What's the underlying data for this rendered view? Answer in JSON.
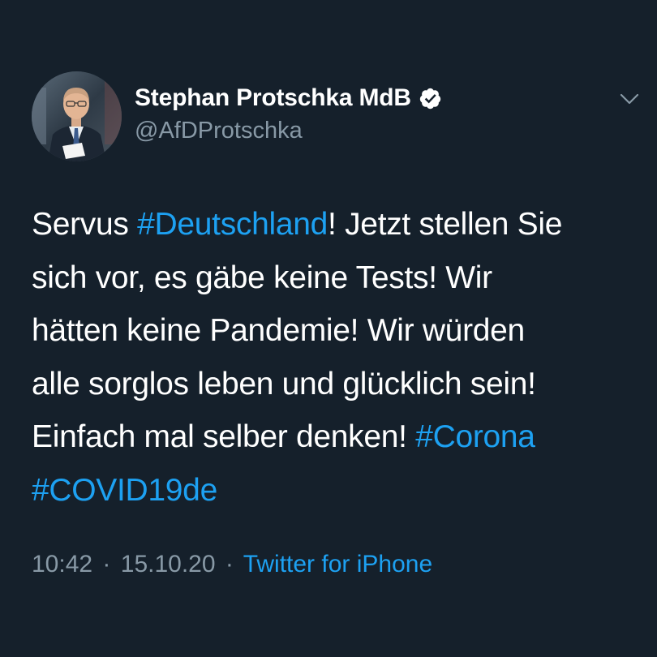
{
  "author": {
    "display_name": "Stephan Protschka MdB",
    "handle": "@AfDProtschka",
    "verified": true,
    "verified_icon": "verified-badge-icon"
  },
  "tweet": {
    "line1": {
      "t1": "Servus ",
      "tag": "#Deutschland",
      "t2": "! Jetzt stellen Sie"
    },
    "line2": "sich vor, es gäbe keine Tests! Wir",
    "line3": "hätten keine Pandemie! Wir würden",
    "line4": "alle sorglos leben und glücklich sein!",
    "line5": {
      "t1": "Einfach mal selber denken! ",
      "tag": "#Corona"
    },
    "line6": {
      "tag": "#COVID19de"
    }
  },
  "meta": {
    "time": "10:42",
    "separator": "·",
    "date": "15.10.20",
    "source": "Twitter for iPhone"
  },
  "colors": {
    "background": "#15202b",
    "text": "#ffffff",
    "secondary": "#8899a6",
    "accent": "#1da1f2"
  },
  "icons": {
    "menu": "chevron-down-icon"
  }
}
